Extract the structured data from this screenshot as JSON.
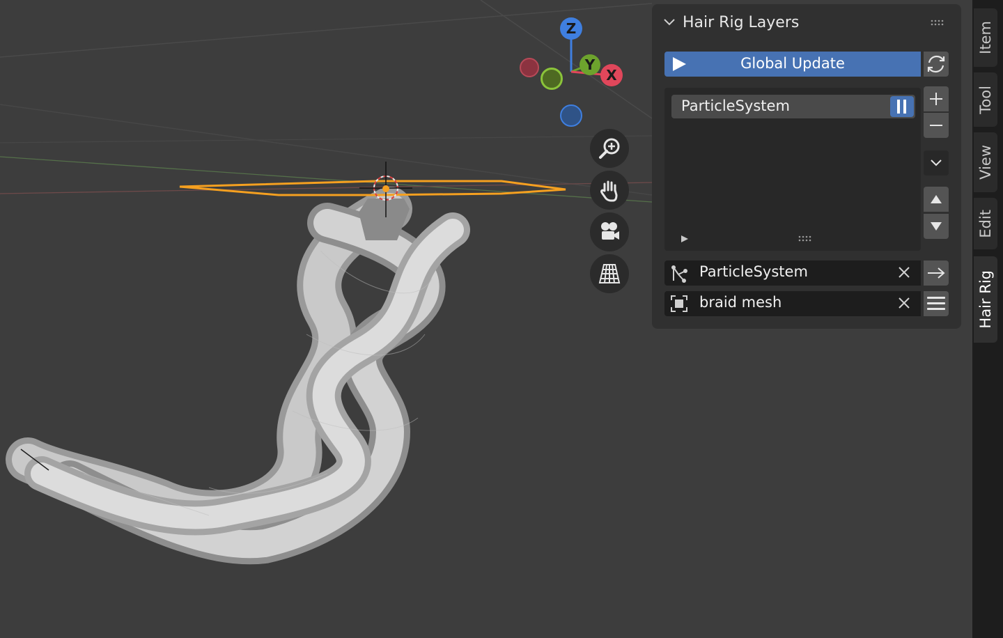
{
  "viewport": {
    "gizmo": {
      "x_label": "X",
      "y_label": "Y",
      "z_label": "Z"
    },
    "nav_buttons": [
      "zoom-icon",
      "hand-icon",
      "camera-icon",
      "grid-icon"
    ]
  },
  "panel": {
    "title": "Hair Rig Layers",
    "global_update_label": "Global Update",
    "list_items": [
      {
        "label": "ParticleSystem"
      }
    ],
    "fields": [
      {
        "value": "ParticleSystem",
        "icon": "particles-icon"
      },
      {
        "value": "braid mesh",
        "icon": "mesh-icon"
      }
    ]
  },
  "tabs": [
    "Item",
    "Tool",
    "View",
    "Edit",
    "Hair Rig"
  ],
  "active_tab": "Hair Rig",
  "colors": {
    "accent": "#4772b3",
    "selection": "#f5a020"
  }
}
